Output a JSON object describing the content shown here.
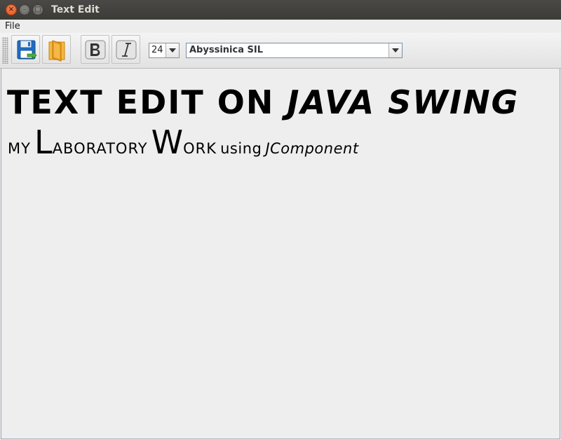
{
  "window": {
    "title": "Text Edit",
    "close_glyph": "×",
    "minimize_glyph": "–",
    "maximize_glyph": "□"
  },
  "menubar": {
    "items": [
      {
        "label": "File"
      }
    ]
  },
  "toolbar": {
    "icons": [
      "save-icon",
      "open-icon",
      "bold-icon",
      "italic-icon"
    ],
    "font_size": "24",
    "font_family": "Abyssinica SIL"
  },
  "document": {
    "line1": {
      "bold_text": "TEXT EDIT ON ",
      "bold_italic_text": "JAVA SWING"
    },
    "line2": {
      "w1": "MY",
      "w2_cap": "L",
      "w2_rest": "ABORATORY",
      "w3_cap": "W",
      "w3_rest": "ORK",
      "w4": "using",
      "w5": "JComponent"
    }
  },
  "colors": {
    "titlebar": "#3c3b37",
    "close_button": "#e0501b",
    "save_icon_blue": "#1e6fc4",
    "open_icon_orange": "#f0a020",
    "editor_background": "#eeeeee"
  }
}
